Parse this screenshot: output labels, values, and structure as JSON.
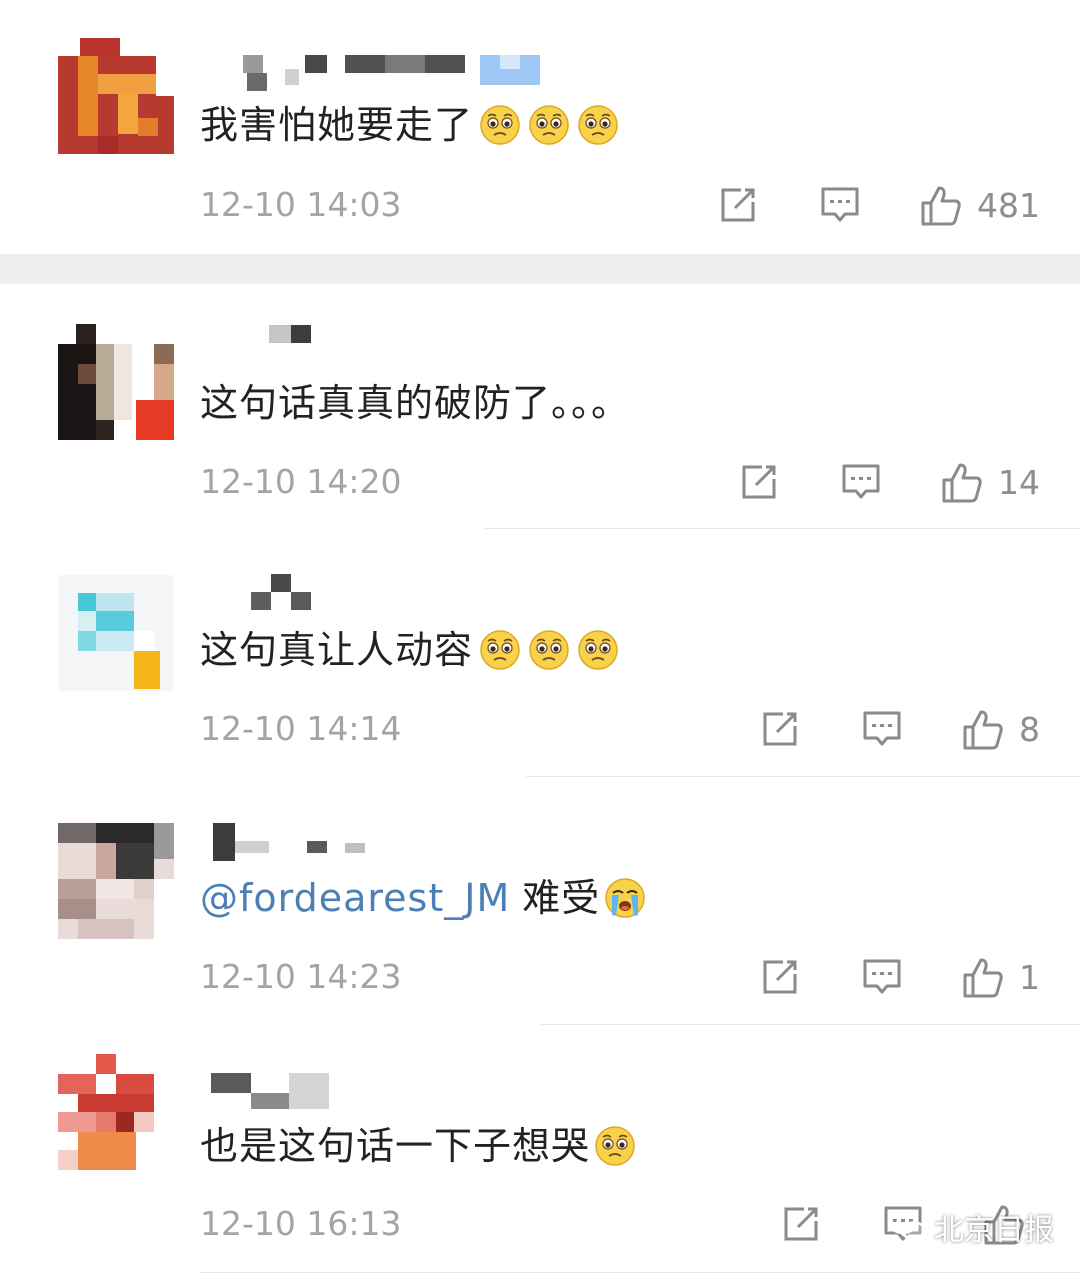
{
  "comments": [
    {
      "text": "我害怕她要走了",
      "mention": "",
      "emojis": [
        "pleading-face-icon",
        "pleading-face-icon",
        "pleading-face-icon"
      ],
      "time": "12-10 14:03",
      "likes": "481"
    },
    {
      "text": "这句话真真的破防了。。。",
      "mention": "",
      "emojis": [],
      "time": "12-10 14:20",
      "likes": "14"
    },
    {
      "text": "这句真让人动容",
      "mention": "",
      "emojis": [
        "pleading-face-icon",
        "pleading-face-icon",
        "pleading-face-icon"
      ],
      "time": "12-10 14:14",
      "likes": "8"
    },
    {
      "text": "难受",
      "mention": "@fordearest_JM",
      "emojis": [
        "crying-face-icon"
      ],
      "time": "12-10 14:23",
      "likes": "1"
    },
    {
      "text": "也是这句话一下子想哭",
      "mention": "",
      "emojis": [
        "pleading-face-icon"
      ],
      "time": "12-10 16:13",
      "likes": ""
    }
  ],
  "watermark": {
    "label": "北京日报",
    "icon": "wechat-icon"
  },
  "colors": {
    "text": "#222222",
    "meta": "#a4a4a4",
    "mention": "#4c7fb5",
    "icon_stroke": "#8a8a8a"
  }
}
